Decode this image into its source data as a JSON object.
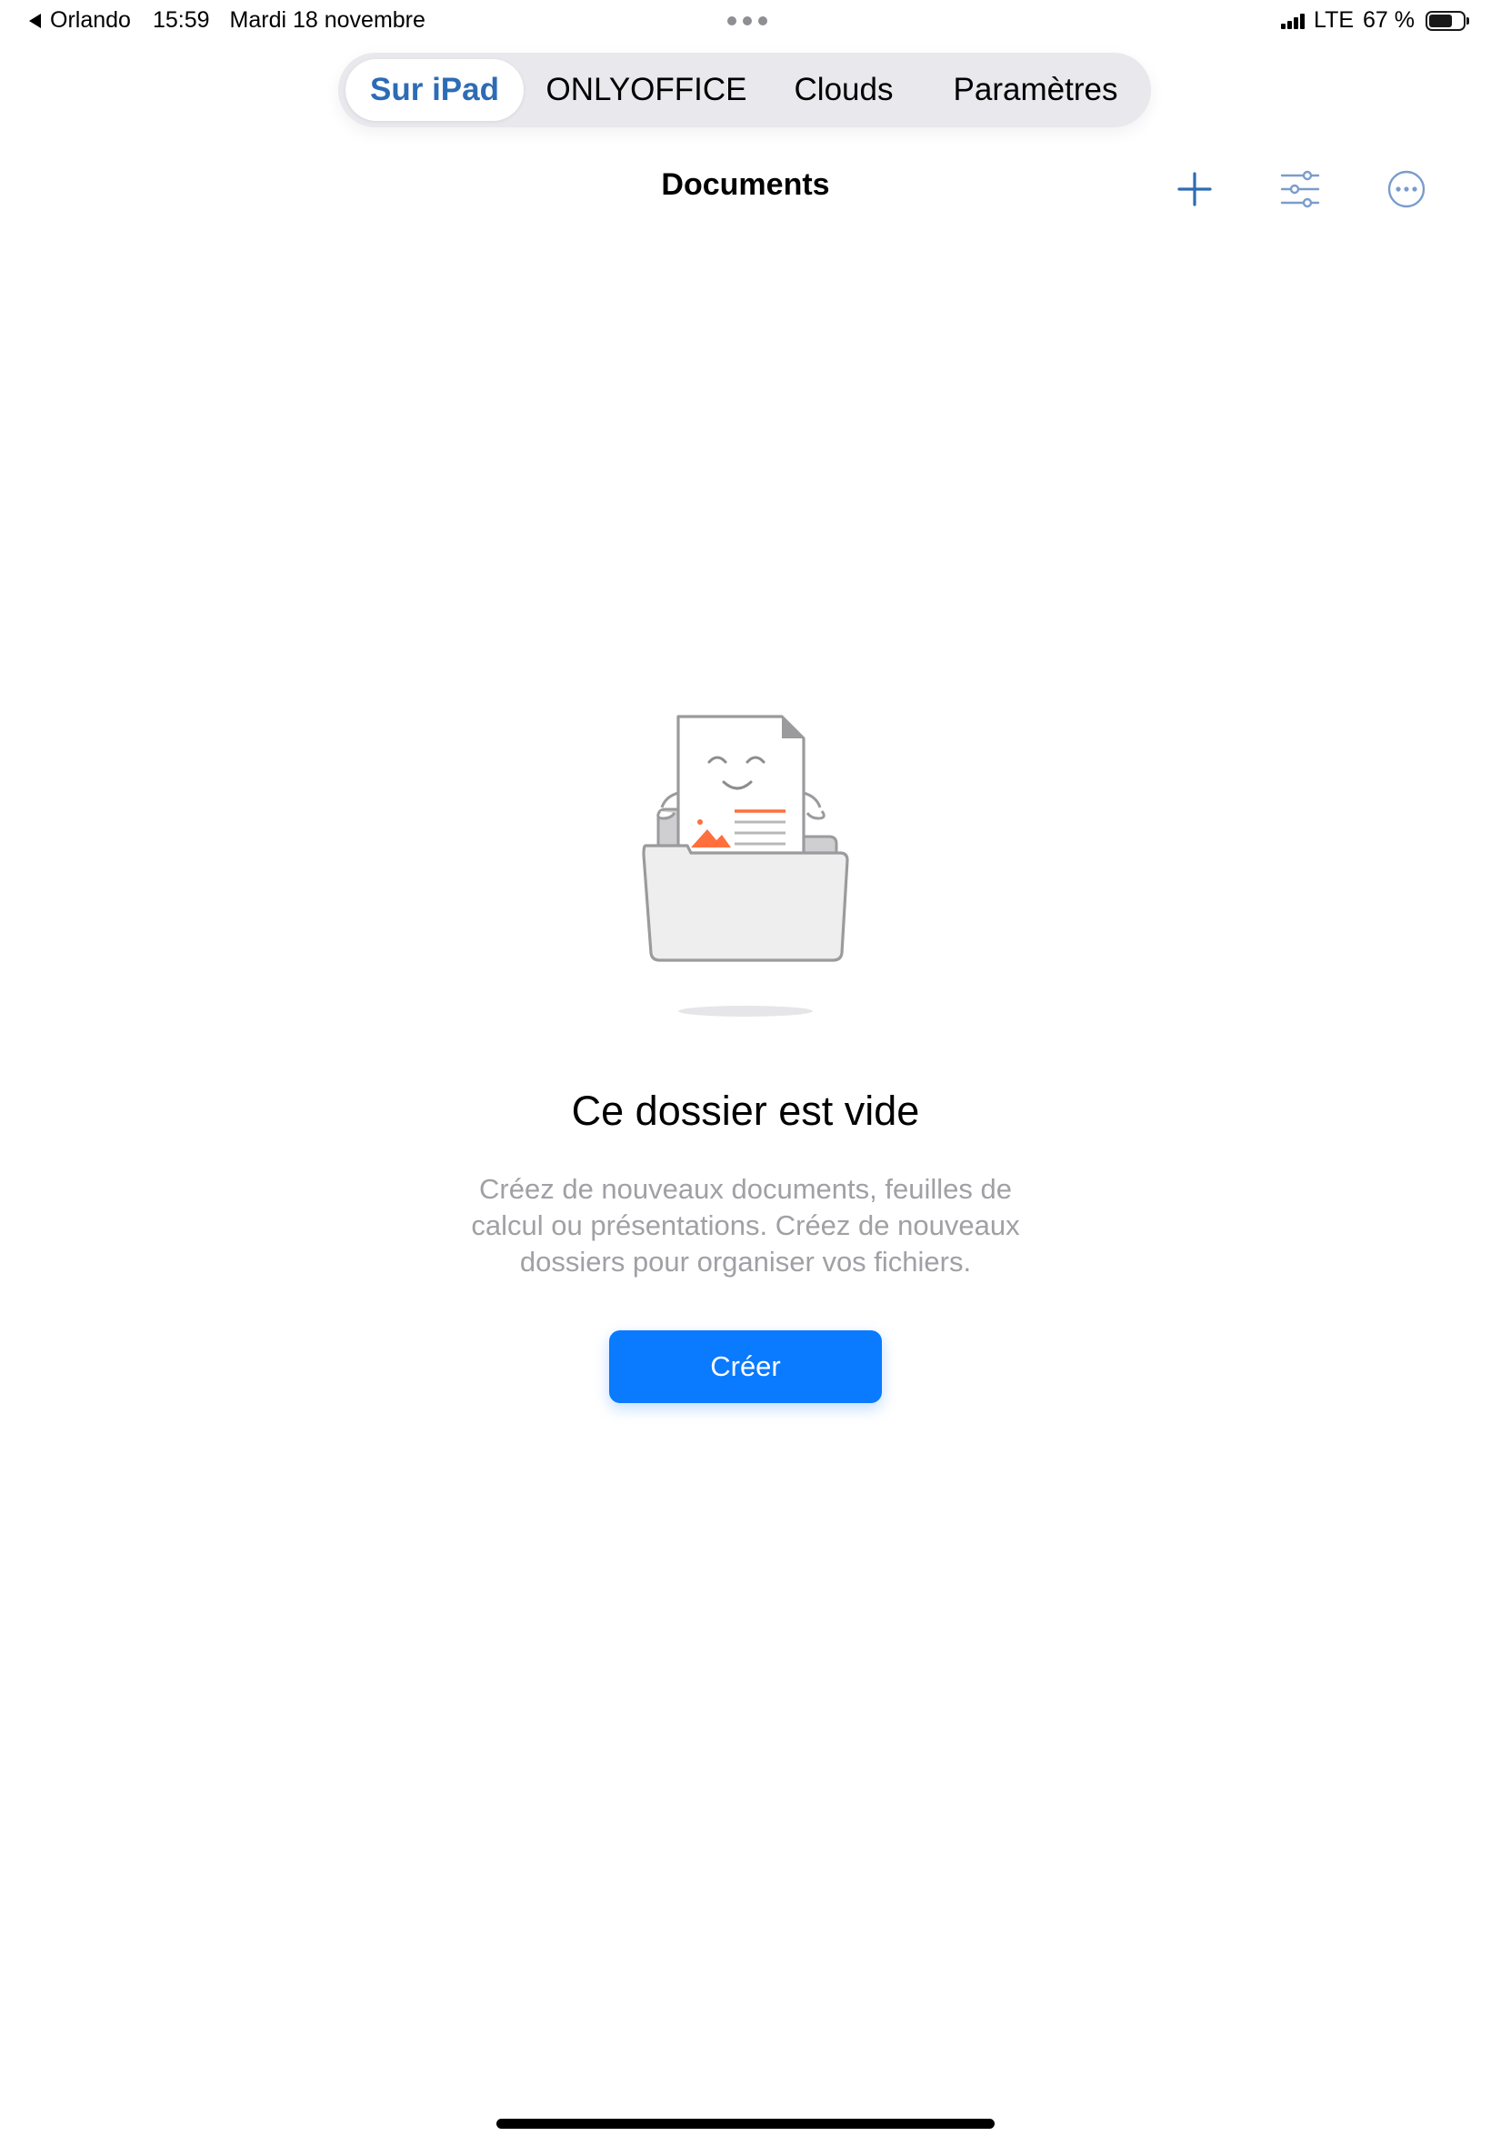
{
  "status_bar": {
    "back_app": "Orlando",
    "time": "15:59",
    "date": "Mardi 18 novembre",
    "network": "LTE",
    "battery": "67 %",
    "battery_level": 0.67
  },
  "tabs": [
    {
      "label": "Sur iPad",
      "active": true
    },
    {
      "label": "ONLYOFFICE",
      "active": false
    },
    {
      "label": "Clouds",
      "active": false
    },
    {
      "label": "Paramètres",
      "active": false
    }
  ],
  "nav": {
    "title": "Documents",
    "add_icon": "plus-icon",
    "filter_icon": "sliders-icon",
    "more_icon": "ellipsis-circle-icon"
  },
  "empty_state": {
    "title": "Ce dossier est vide",
    "description": "Créez de nouveaux documents, feuilles de calcul ou présentations. Créez de nouveaux dossiers pour organiser vos fichiers.",
    "button_label": "Créer",
    "illustration": "empty-folder-document-illustration"
  },
  "colors": {
    "accent": "#2d6cb5",
    "button": "#0a7aff",
    "illustration_accent": "#ff6f3d",
    "secondary_text": "#a0a0a5"
  }
}
